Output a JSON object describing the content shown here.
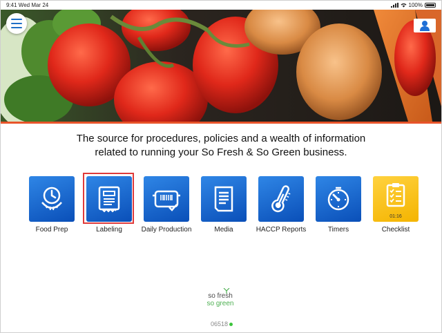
{
  "status": {
    "time": "9:41  Wed Mar 24",
    "battery": "100%"
  },
  "header": {
    "menu_icon": "hamburger-menu-icon",
    "user_icon": "user-icon"
  },
  "headline": {
    "line1": "The source for procedures, policies and a wealth of information",
    "line2": "related to running your So Fresh & So Green business."
  },
  "tiles": [
    {
      "label": "Food Prep",
      "icon": "clock-plate-icon",
      "color": "#1f6fd6"
    },
    {
      "label": "Labeling",
      "icon": "label-printer-icon",
      "color": "#1f6fd6",
      "selected": true
    },
    {
      "label": "Daily Production",
      "icon": "container-barcode-icon",
      "color": "#1f6fd6"
    },
    {
      "label": "Media",
      "icon": "document-icon",
      "color": "#1f6fd6"
    },
    {
      "label": "HACCP Reports",
      "icon": "thermometer-icon",
      "color": "#1f6fd6"
    },
    {
      "label": "Timers",
      "icon": "timer-icon",
      "color": "#1f6fd6"
    },
    {
      "label": "Checklist",
      "icon": "clipboard-checklist-icon",
      "color": "#f4b400",
      "badge": "01:16"
    }
  ],
  "brand": {
    "line1": "so fresh",
    "line2": "so green"
  },
  "device_code": "06518",
  "colors": {
    "accent_line": "#e8542a",
    "selection": "#e03a3a",
    "status_dot": "#3cc43c"
  }
}
